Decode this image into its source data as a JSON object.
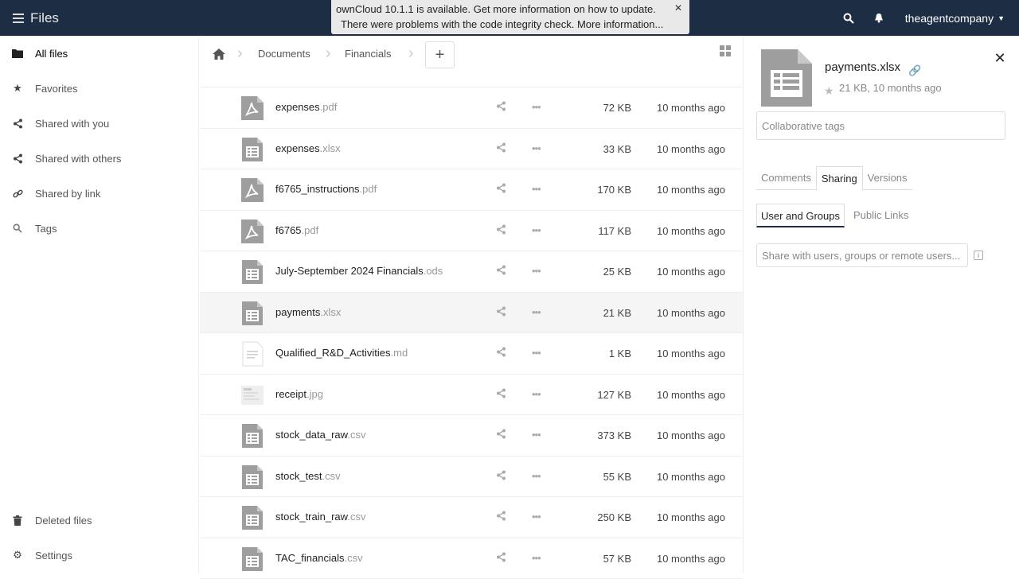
{
  "header": {
    "app_name": "Files",
    "notice_update": "ownCloud 10.1.1 is available. Get more information on how to update.",
    "notice_integrity": "There were problems with the code integrity check. More information...",
    "user": "theagentcompany"
  },
  "sidebar": {
    "items": [
      {
        "label": "All files",
        "icon": "folder-icon"
      },
      {
        "label": "Favorites",
        "icon": "star-icon"
      },
      {
        "label": "Shared with you",
        "icon": "share-icon"
      },
      {
        "label": "Shared with others",
        "icon": "share-icon"
      },
      {
        "label": "Shared by link",
        "icon": "link-icon"
      },
      {
        "label": "Tags",
        "icon": "search-icon"
      }
    ],
    "deleted": "Deleted files",
    "settings": "Settings"
  },
  "breadcrumb": [
    "Documents",
    "Financials"
  ],
  "files": [
    {
      "name": "expenses",
      "ext": ".pdf",
      "size": "72 KB",
      "date": "10 months ago",
      "type": "pdf"
    },
    {
      "name": "expenses",
      "ext": ".xlsx",
      "size": "33 KB",
      "date": "10 months ago",
      "type": "sheet"
    },
    {
      "name": "f6765_instructions",
      "ext": ".pdf",
      "size": "170 KB",
      "date": "10 months ago",
      "type": "pdf"
    },
    {
      "name": "f6765",
      "ext": ".pdf",
      "size": "117 KB",
      "date": "10 months ago",
      "type": "pdf"
    },
    {
      "name": "July-September 2024 Financials",
      "ext": ".ods",
      "size": "25 KB",
      "date": "10 months ago",
      "type": "sheet"
    },
    {
      "name": "payments",
      "ext": ".xlsx",
      "size": "21 KB",
      "date": "10 months ago",
      "type": "sheet"
    },
    {
      "name": "Qualified_R&D_Activities",
      "ext": ".md",
      "size": "1 KB",
      "date": "10 months ago",
      "type": "text"
    },
    {
      "name": "receipt",
      "ext": ".jpg",
      "size": "127 KB",
      "date": "10 months ago",
      "type": "image"
    },
    {
      "name": "stock_data_raw",
      "ext": ".csv",
      "size": "373 KB",
      "date": "10 months ago",
      "type": "sheet"
    },
    {
      "name": "stock_test",
      "ext": ".csv",
      "size": "55 KB",
      "date": "10 months ago",
      "type": "sheet"
    },
    {
      "name": "stock_train_raw",
      "ext": ".csv",
      "size": "250 KB",
      "date": "10 months ago",
      "type": "sheet"
    },
    {
      "name": "TAC_financials",
      "ext": ".csv",
      "size": "57 KB",
      "date": "10 months ago",
      "type": "sheet"
    }
  ],
  "details": {
    "filename": "payments.xlsx",
    "meta": "21 KB, 10 months ago",
    "tags_placeholder": "Collaborative tags",
    "tabs": [
      "Comments",
      "Sharing",
      "Versions"
    ],
    "subtabs": [
      "User and Groups",
      "Public Links"
    ],
    "share_placeholder": "Share with users, groups or remote users..."
  },
  "colors": {
    "header": "#1d2d44",
    "sheet_icon": "#9e9e9e",
    "pdf_icon": "#9e9e9e"
  }
}
